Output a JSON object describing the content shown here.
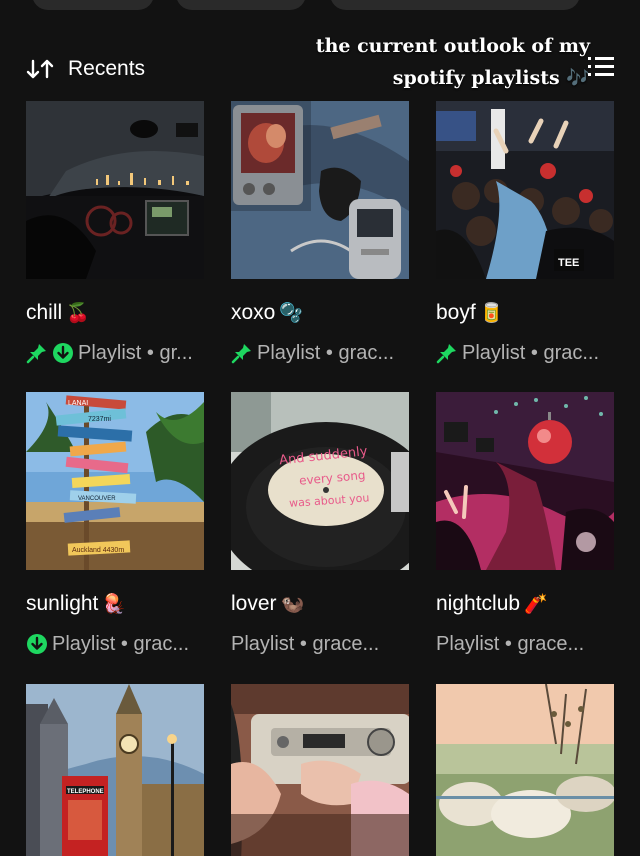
{
  "header": {
    "sort_label": "Recents",
    "caption_line1": "the current outlook of my",
    "caption_line2": "spotify playlists 🎶"
  },
  "icons": {
    "sort": "sort-arrows-icon",
    "view": "list-view-icon",
    "pinned": "pin-icon",
    "downloaded": "download-icon"
  },
  "colors": {
    "background": "#121212",
    "accent_green": "#1ed760",
    "secondary_text": "#b3b3b3"
  },
  "playlists": [
    {
      "title": "chill",
      "emoji": "🍒",
      "subtitle": "Playlist • gr...",
      "pinned": true,
      "downloaded": true
    },
    {
      "title": "xoxo",
      "emoji": "🫧",
      "subtitle": "Playlist • grac...",
      "pinned": true,
      "downloaded": false
    },
    {
      "title": "boyf",
      "emoji": "🥫",
      "subtitle": "Playlist • grac...",
      "pinned": true,
      "downloaded": false
    },
    {
      "title": "sunlight",
      "emoji": "🪼",
      "subtitle": "Playlist • grac...",
      "pinned": false,
      "downloaded": true
    },
    {
      "title": "lover",
      "emoji": "🦦",
      "subtitle": "Playlist • grace...",
      "pinned": false,
      "downloaded": false
    },
    {
      "title": "nightclub",
      "emoji": "🧨",
      "subtitle": "Playlist • grace...",
      "pinned": false,
      "downloaded": false
    },
    {
      "title": "",
      "emoji": "",
      "subtitle": "",
      "pinned": false,
      "downloaded": false
    },
    {
      "title": "",
      "emoji": "",
      "subtitle": "",
      "pinned": false,
      "downloaded": false
    },
    {
      "title": "",
      "emoji": "",
      "subtitle": "",
      "pinned": false,
      "downloaded": false
    }
  ],
  "covers": {
    "c1_sign_texts": [
      "LANAI",
      "7237mi",
      "VANCOUVER",
      "Auckland 4430m"
    ],
    "c2_record_text": [
      "And suddenly",
      "every song",
      "was about you"
    ],
    "c3_sign_text": "TELEPHONE",
    "c4_shirt_text": "TEE"
  }
}
